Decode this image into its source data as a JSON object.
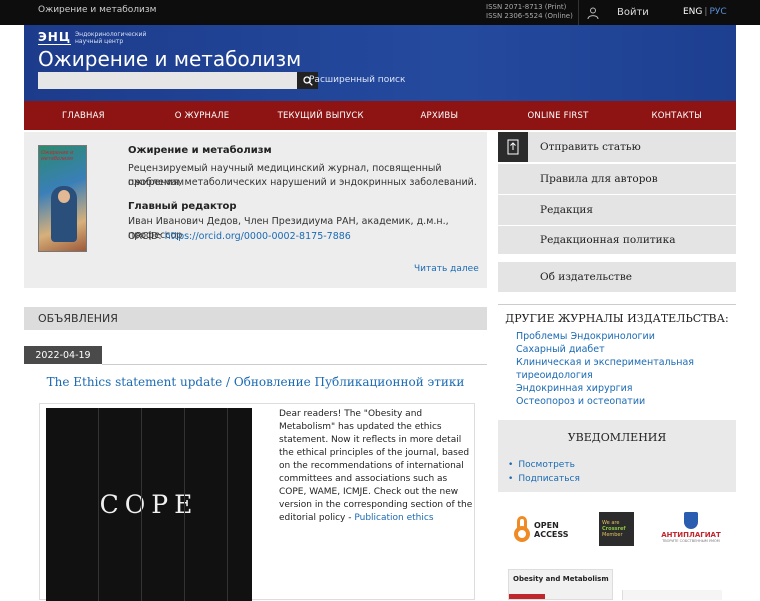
{
  "topbar": {
    "breadcrumb": "Ожирение и метаболизм",
    "issn_print": "ISSN 2071-8713 (Print)",
    "issn_online": "ISSN 2306-5524 (Online)",
    "login_label": "Войти",
    "lang_eng": "ENG",
    "lang_sep": "|",
    "lang_rus": "РУС"
  },
  "header": {
    "logo_mark": "ЭНЦ",
    "logo_sub_1": "Эндокринологический",
    "logo_sub_2": "научный центр",
    "title": "Ожирение и метаболизм",
    "search_placeholder": "",
    "advanced_search": "Расширенный поиск"
  },
  "nav": {
    "items": [
      "ГЛАВНАЯ",
      "О ЖУРНАЛЕ",
      "ТЕКУЩИЙ ВЫПУСК",
      "АРХИВЫ",
      "ONLINE FIRST",
      "КОНТАКТЫ"
    ]
  },
  "about": {
    "cover_title": "Ожирение и метаболизм",
    "title": "Ожирение и метаболизм",
    "desc_1": "Рецензируемый научный медицинский журнал, посвященный проблемам",
    "desc_2": "ожирения, метаболических нарушений и эндокринных заболеваний.",
    "editor_heading": "Главный редактор",
    "editor_name": "Иван Иванович Дедов, Член Президиума РАН, академик, д.м.н., профессор",
    "orcid_label": "ORCID:",
    "orcid_link": "https://orcid.org/0000-0002-8175-7886",
    "read_more": "Читать далее"
  },
  "announcements": {
    "heading": "ОБЪЯВЛЕНИЯ",
    "date": "2022-04-19",
    "title": "The Ethics statement update / Обновление Публикационной этики",
    "image_text": "COPE",
    "body": "Dear readers! The \"Obesity and Metabolism\" has updated the ethics statement. Now it reflects in more detail the ethical principles of the journal, based on the recommendations of international committees and associations such as COPE, WAME, ICMJE. Check out the new version in the corresponding section of the editorial policy -",
    "body_link": "Publication ethics"
  },
  "sidebar": {
    "submit": "Отправить статью",
    "rules": "Правила для авторов",
    "editorial": "Редакция",
    "policy": "Редакционная политика",
    "publisher": "Об издательстве",
    "other_journals_heading": "ДРУГИЕ ЖУРНАЛЫ ИЗДАТЕЛЬСТВА:",
    "other_journals": [
      "Проблемы Эндокринологии",
      "Сахарный диабет",
      "Клиническая и экспериментальная тиреоидология",
      "Эндокринная хирургия",
      "Остеопороз и остеопатии"
    ],
    "notifications_heading": "УВЕДОМЛЕНИЯ",
    "notifications": [
      "Посмотреть",
      "Подписаться"
    ],
    "oa_text_1": "OPEN",
    "oa_text_2": "ACCESS",
    "crossref_1": "We are",
    "crossref_2": "Crossref",
    "crossref_3": "Member",
    "antiplagiat": "АНТИПЛАГИАТ",
    "antiplagiat_sub": "ТВОРИТЕ СОБСТВЕННЫМ УМОМ",
    "journal_card": "Obesity and Metabolism"
  },
  "colors": {
    "header_blue": "#1d3b8b",
    "nav_red": "#8e1414",
    "link": "#1b6ab3"
  }
}
